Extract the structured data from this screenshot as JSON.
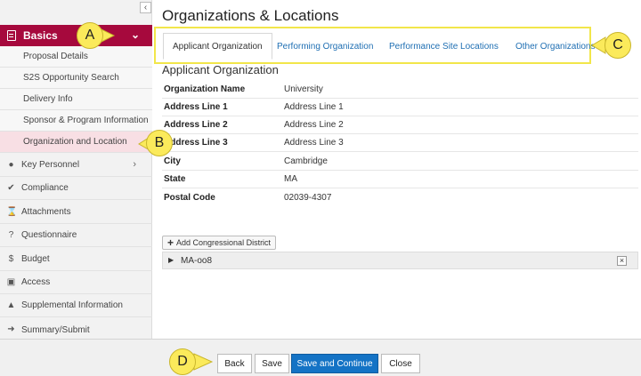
{
  "page": {
    "title": "Organizations & Locations"
  },
  "sidebar": {
    "collapse_glyph": "‹",
    "header": {
      "label": "Basics"
    },
    "sub_items": [
      {
        "label": "Proposal Details"
      },
      {
        "label": "S2S Opportunity Search"
      },
      {
        "label": "Delivery Info"
      },
      {
        "label": "Sponsor & Program Information"
      },
      {
        "label": "Organization and Location"
      }
    ],
    "items": [
      {
        "label": "Key Personnel",
        "icon": "person-icon"
      },
      {
        "label": "Compliance",
        "icon": "check-icon"
      },
      {
        "label": "Attachments",
        "icon": "paperclip-icon"
      },
      {
        "label": "Questionnaire",
        "icon": "question-icon"
      },
      {
        "label": "Budget",
        "icon": "money-icon"
      },
      {
        "label": "Access",
        "icon": "lock-icon"
      },
      {
        "label": "Supplemental Information",
        "icon": "bell-icon"
      },
      {
        "label": "Summary/Submit",
        "icon": "submit-icon"
      }
    ]
  },
  "tabs": [
    {
      "label": "Applicant Organization"
    },
    {
      "label": "Performing Organization"
    },
    {
      "label": "Performance Site Locations"
    },
    {
      "label": "Other Organizations"
    }
  ],
  "section": {
    "title": "Applicant Organization",
    "rows": [
      {
        "label": "Organization Name",
        "value": "University"
      },
      {
        "label": "Address Line 1",
        "value": "Address Line 1"
      },
      {
        "label": "Address Line 2",
        "value": "Address Line 2"
      },
      {
        "label": "Address Line 3",
        "value": "Address Line 3"
      },
      {
        "label": "City",
        "value": "Cambridge"
      },
      {
        "label": "State",
        "value": "MA"
      },
      {
        "label": "Postal Code",
        "value": "02039-4307"
      }
    ]
  },
  "congressional": {
    "add_label": "Add Congressional District",
    "district": "MA-oo8",
    "remove_glyph": "×"
  },
  "footer": {
    "back": "Back",
    "save": "Save",
    "save_continue": "Save and Continue",
    "close": "Close"
  },
  "callouts": {
    "a": "A",
    "b": "B",
    "c": "C",
    "d": "D"
  },
  "colors": {
    "brand": "#a6093d",
    "primary_button": "#1473c5",
    "callout": "#fbea5b",
    "tab_highlight": "#f2e64a",
    "link": "#1f6fb3"
  }
}
